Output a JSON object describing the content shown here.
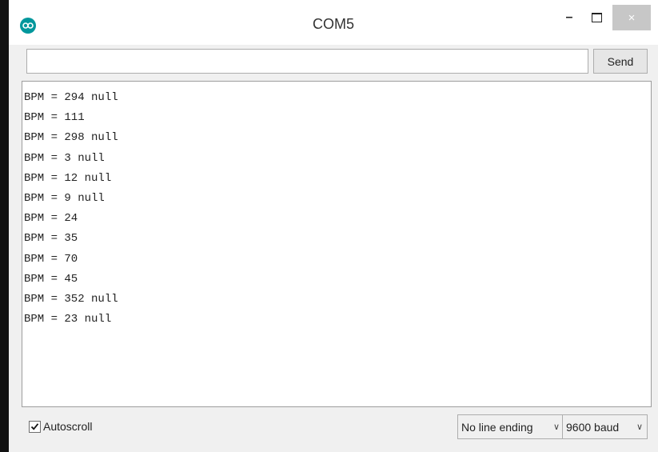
{
  "window": {
    "title": "COM5",
    "close_glyph": "×",
    "minimize_glyph": "–"
  },
  "send_bar": {
    "input_value": "",
    "send_label": "Send"
  },
  "output": {
    "lines": [
      "BPM = 294 null",
      "BPM = 111",
      "BPM = 298 null",
      "BPM = 3 null",
      "BPM = 12 null",
      "BPM = 9 null",
      "BPM = 24",
      "BPM = 35",
      "BPM = 70",
      "BPM = 45",
      "BPM = 352 null",
      "BPM = 23 null"
    ]
  },
  "footer": {
    "autoscroll_label": "Autoscroll",
    "autoscroll_checked": true,
    "line_ending_selected": "No line ending",
    "baud_selected": "9600 baud",
    "chevron_glyph": "∨"
  },
  "colors": {
    "icon_teal": "#00979c",
    "close_button": "#c7c7c7",
    "background": "#f0f0f0"
  },
  "icons": [
    "arduino-logo-icon",
    "minimize-icon",
    "maximize-icon",
    "close-icon",
    "checkbox-check-icon",
    "chevron-down-icon"
  ]
}
